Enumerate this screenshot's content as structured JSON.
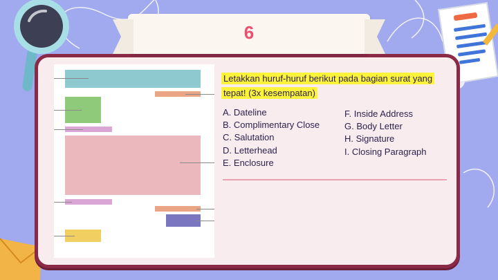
{
  "slide": {
    "number": "6",
    "instruction": "Letakkan huruf-huruf berikut pada bagian surat yang tepat! (3x kesempatan)",
    "options_left": [
      "A. Dateline",
      "B. Complimentary Close",
      "C. Salutation",
      "D. Letterhead",
      "E. Enclosure"
    ],
    "options_right": [
      "F. Inside Address",
      "G. Body Letter",
      "H. Signature",
      "I. Closing Paragraph"
    ]
  },
  "colors": {
    "background": "#a1a9ef",
    "card_border": "#8a2a47",
    "card_fill": "#f8ecee",
    "number": "#ec4f6e",
    "highlight": "#fcf33a",
    "letterhead_block": "#8fc9d0",
    "dateline_block": "#e9a584",
    "inside_address_block": "#8fc97a",
    "salutation_block": "#d9a6d6",
    "body_block": "#ebb8bd",
    "closing_block": "#d9a6d6",
    "complimentary_block": "#e9a584",
    "signature_block": "#7a76c0",
    "enclosure_block": "#f2cf61"
  },
  "decorations": [
    "magnifier-icon",
    "document-icon",
    "envelope-icon"
  ]
}
